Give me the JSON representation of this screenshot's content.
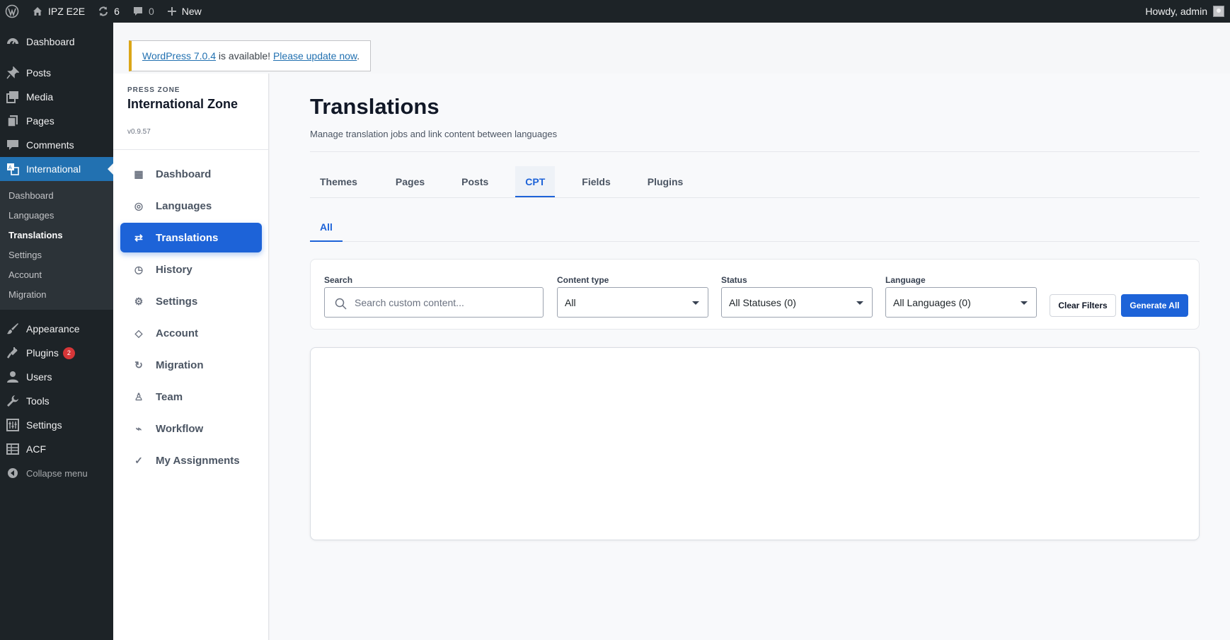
{
  "adminbar": {
    "site_name": "IPZ E2E",
    "updates_count": "6",
    "comments_count": "0",
    "new_label": "New",
    "greeting": "Howdy, admin"
  },
  "wp_menu": {
    "items_top": [
      {
        "label": "Dashboard",
        "icon": "dashboard-icon"
      },
      {
        "label": "Posts",
        "icon": "pin-icon"
      },
      {
        "label": "Media",
        "icon": "media-icon"
      },
      {
        "label": "Pages",
        "icon": "pages-icon"
      },
      {
        "label": "Comments",
        "icon": "comment-icon"
      },
      {
        "label": "International",
        "icon": "translation-icon"
      }
    ],
    "submenu": [
      "Dashboard",
      "Languages",
      "Translations",
      "Settings",
      "Account",
      "Migration"
    ],
    "items_bottom": [
      {
        "label": "Appearance",
        "icon": "brush-icon"
      },
      {
        "label": "Plugins",
        "icon": "plug-icon",
        "badge": "2"
      },
      {
        "label": "Users",
        "icon": "user-icon"
      },
      {
        "label": "Tools",
        "icon": "wrench-icon"
      },
      {
        "label": "Settings",
        "icon": "settings-icon"
      },
      {
        "label": "ACF",
        "icon": "grid-icon"
      }
    ],
    "collapse_label": "Collapse menu"
  },
  "notice": {
    "link1": "WordPress 7.0.4",
    "middle": " is available! ",
    "link2": "Please update now",
    "end": "."
  },
  "plugin": {
    "kicker": "PRESS ZONE",
    "title": "International Zone",
    "version": "v0.9.57",
    "nav": [
      {
        "label": "Dashboard",
        "glyph": "▦"
      },
      {
        "label": "Languages",
        "glyph": "◎"
      },
      {
        "label": "Translations",
        "glyph": "⇄"
      },
      {
        "label": "History",
        "glyph": "◷"
      },
      {
        "label": "Settings",
        "glyph": "⚙"
      },
      {
        "label": "Account",
        "glyph": "◇"
      },
      {
        "label": "Migration",
        "glyph": "↻"
      },
      {
        "label": "Team",
        "glyph": "♙"
      },
      {
        "label": "Workflow",
        "glyph": "⌁"
      },
      {
        "label": "My Assignments",
        "glyph": "✓"
      }
    ]
  },
  "page": {
    "title": "Translations",
    "description": "Manage translation jobs and link content between languages",
    "tabs": [
      "Themes",
      "Pages",
      "Posts",
      "CPT",
      "Fields",
      "Plugins"
    ],
    "active_tab": "CPT",
    "subtab": "All"
  },
  "filters": {
    "search_label": "Search",
    "search_placeholder": "Search custom content...",
    "content_type_label": "Content type",
    "content_type_value": "All",
    "status_label": "Status",
    "status_value": "All Statuses (0)",
    "language_label": "Language",
    "language_value": "All Languages (0)",
    "clear_label": "Clear Filters",
    "generate_label": "Generate All"
  },
  "colors": {
    "wp_admin_bg": "#1d2327",
    "wp_accent": "#2271b1",
    "plugin_accent": "#1d63d8",
    "notice_border": "#dba617"
  }
}
